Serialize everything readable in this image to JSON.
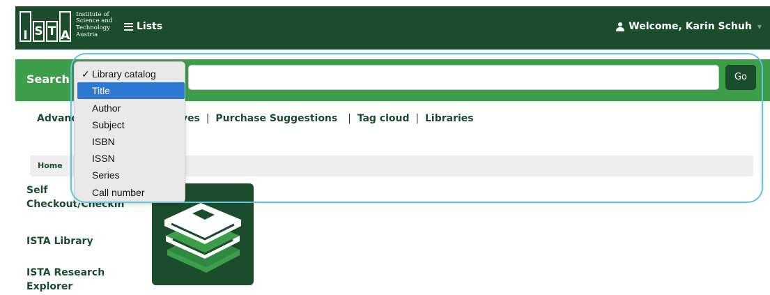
{
  "header": {
    "logo_letters": [
      "I",
      "S",
      "T",
      "A"
    ],
    "logo_text": [
      "Institute of",
      "Science and",
      "Technology",
      "Austria"
    ],
    "lists_label": "Lists",
    "welcome_label": "Welcome, Karin Schuh",
    "icons": {
      "lists": "list-icon",
      "user": "user-icon",
      "caret": "caret-down-icon"
    }
  },
  "search": {
    "label": "Search",
    "input_value": "",
    "go_label": "Go",
    "dropdown": {
      "selected": "Library catalog",
      "highlighted": "Title",
      "options": [
        "Library catalog",
        "Title",
        "Author",
        "Subject",
        "ISBN",
        "ISSN",
        "Series",
        "Call number"
      ]
    }
  },
  "nav": {
    "links_line": [
      "Advanc",
      "eserves",
      "Purchase Suggestions",
      "Tag cloud",
      "Libraries"
    ],
    "separators": [
      "|",
      "|",
      "|"
    ]
  },
  "breadcrumb": {
    "home": "Home"
  },
  "sidebar": {
    "items": [
      {
        "line1": "Self",
        "line2": "Checkout/Checkin"
      },
      {
        "line1": "ISTA Library"
      },
      {
        "line1": "ISTA Research",
        "line2": "Explorer"
      }
    ]
  },
  "tile": {
    "icon": "books-icon"
  },
  "colors": {
    "navbar": "#1b4d2c",
    "searchbar": "#3d9e4a",
    "highlight": "#5bc3ea",
    "selection": "#2f78d1"
  }
}
